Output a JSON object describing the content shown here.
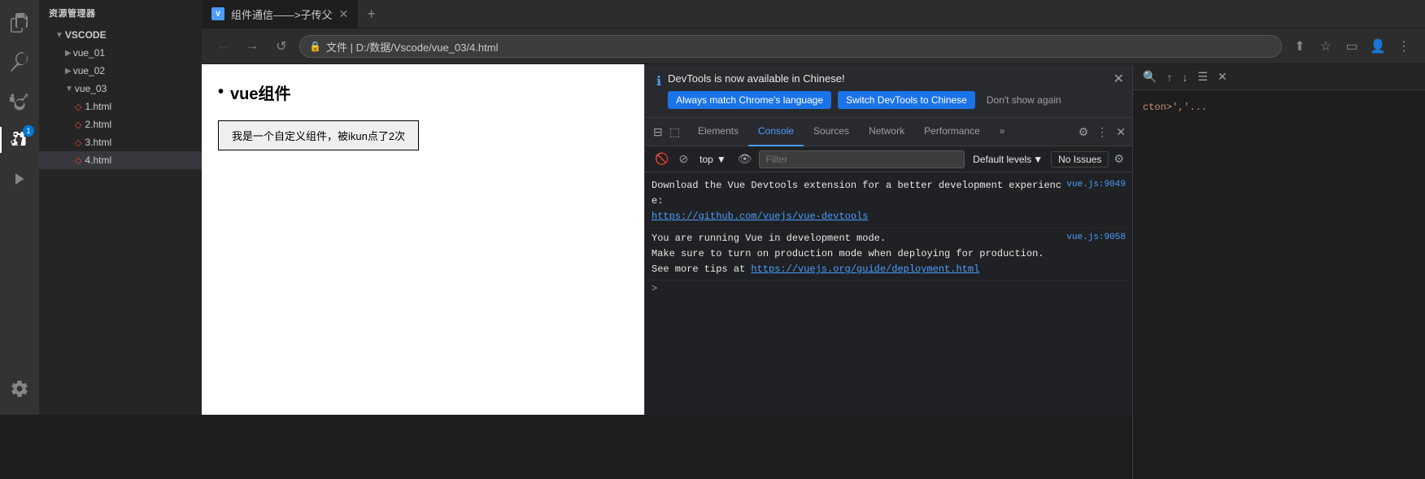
{
  "sidebar": {
    "icons": [
      {
        "name": "explorer-icon",
        "symbol": "⊞",
        "active": false
      },
      {
        "name": "search-icon",
        "symbol": "🔍",
        "active": false
      },
      {
        "name": "git-icon",
        "symbol": "⑂",
        "active": false
      },
      {
        "name": "extensions-icon",
        "symbol": "⊕",
        "active": true,
        "badge": "1"
      },
      {
        "name": "run-icon",
        "symbol": "▷",
        "active": false
      },
      {
        "name": "settings-icon",
        "symbol": "⚙",
        "active": false
      }
    ]
  },
  "explorer": {
    "header": "资源管理器",
    "root_label": "VSCODE",
    "items": [
      {
        "label": "vue_01",
        "type": "folder",
        "indent": 1,
        "expanded": false
      },
      {
        "label": "vue_02",
        "type": "folder",
        "indent": 1,
        "expanded": false
      },
      {
        "label": "vue_03",
        "type": "folder",
        "indent": 1,
        "expanded": true
      },
      {
        "label": "1.html",
        "type": "html",
        "indent": 2
      },
      {
        "label": "2.html",
        "type": "html",
        "indent": 2
      },
      {
        "label": "3.html",
        "type": "html",
        "indent": 2
      },
      {
        "label": "4.html",
        "type": "html",
        "indent": 2,
        "active": true
      }
    ]
  },
  "browser": {
    "tab_title": "组件通信——>子传父",
    "address": "文件 | D:/数据/Vscode/vue_03/4.html",
    "webpage": {
      "title": "vue组件",
      "button_text": "我是一个自定义组件，被ikun点了2次"
    }
  },
  "devtools": {
    "banner": {
      "message": "DevTools is now available in Chinese!",
      "btn_always": "Always match Chrome's language",
      "btn_switch": "Switch DevTools to Chinese",
      "btn_dismiss": "Don't show again"
    },
    "tabs": [
      {
        "label": "Elements"
      },
      {
        "label": "Console",
        "active": true
      },
      {
        "label": "Sources"
      },
      {
        "label": "Network"
      },
      {
        "label": "Performance"
      },
      {
        "label": "»"
      }
    ],
    "console": {
      "context": "top",
      "filter_placeholder": "Filter",
      "level": "Default levels",
      "issues_btn": "No Issues",
      "entries": [
        {
          "text": "Download the Vue Devtools extension for a better development experience:\nhttps://github.com/vuejs/vue-devtools",
          "source": "vue.js:9049",
          "link": "https://github.com/vuejs/vue-devtools"
        },
        {
          "text": "You are running Vue in development mode.\nMake sure to turn on production mode when deploying for production.\nSee more tips at https://vuejs.org/guide/deployment.html",
          "source": "vue.js:9058",
          "link": "https://vuejs.org/guide/deployment.html"
        }
      ],
      "prompt": ">"
    }
  },
  "right_panel": {
    "content": "cton>','..."
  }
}
